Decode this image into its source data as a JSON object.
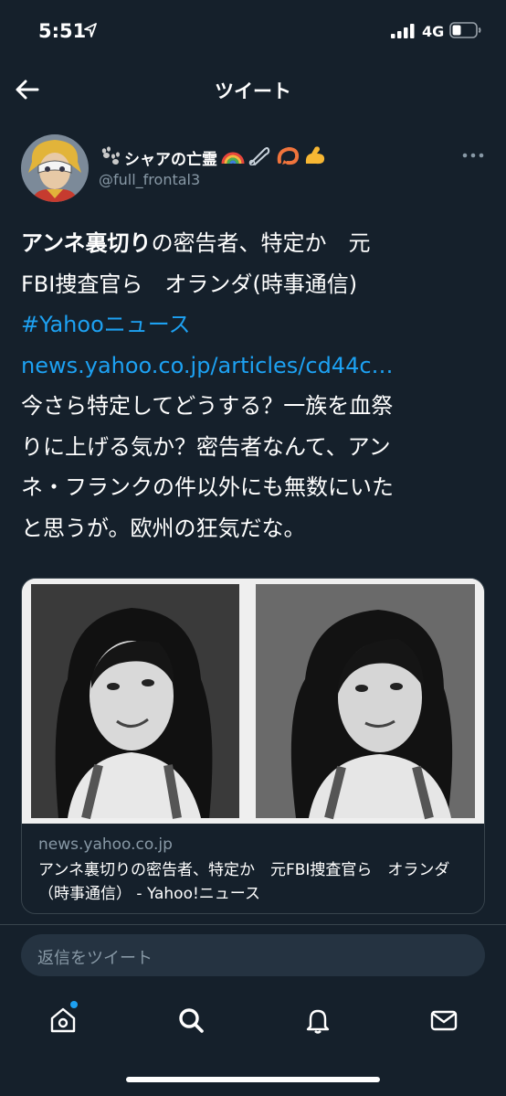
{
  "status_bar": {
    "time": "5:51",
    "network": "4G"
  },
  "header": {
    "title": "ツイート"
  },
  "tweet": {
    "display_name": "シャアの亡霊",
    "handle": "@full_frontal3",
    "text": {
      "headline_bold": "アンネ裏切り",
      "headline_rest": "の密告者、特定か　元",
      "headline_line2": "FBI捜査官ら　オランダ(時事通信)",
      "hashtag": "#Yahooニュース",
      "url": "news.yahoo.co.jp/articles/cd44c…",
      "comment_lines": [
        "今さら特定してどうする？一族を血祭",
        "りに上げる気か？密告者なんて、アン",
        "ネ・フランクの件以外にも無数にいた",
        "と思うが。欧州の狂気だな。"
      ]
    },
    "card": {
      "domain": "news.yahoo.co.jp",
      "title": "アンネ裏切りの密告者、特定か　元FBI捜査官ら　オランダ（時事通信） - Yahoo!ニュース"
    }
  },
  "reply": {
    "placeholder": "返信をツイート"
  },
  "tabs": [
    "home-icon",
    "search-icon",
    "notifications-icon",
    "messages-icon"
  ],
  "colors": {
    "background": "#15202b",
    "link": "#1da1f2",
    "secondary_text": "#8899a6",
    "border": "#38444d",
    "input_background": "#253341"
  }
}
